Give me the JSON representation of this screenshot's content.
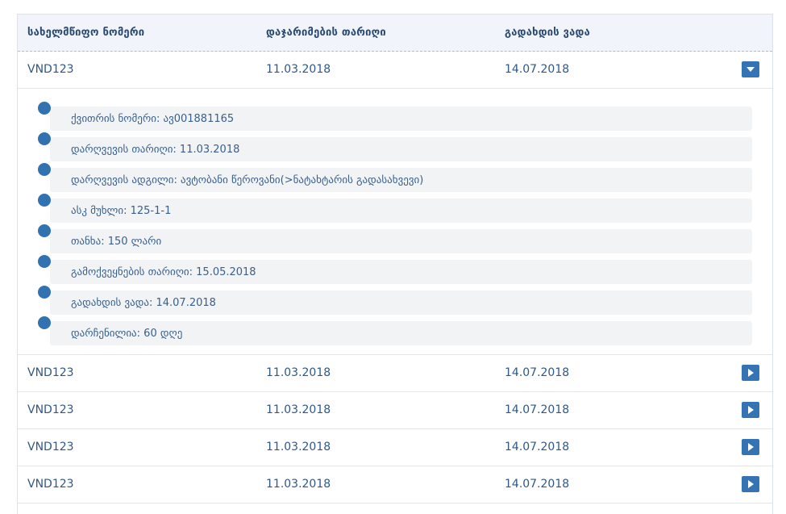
{
  "header": {
    "col_plate": "სახელმწიფო ნომერი",
    "col_violation_date": "დაჯარიმების თარიღი",
    "col_due_date": "გადახდის ვადა"
  },
  "expanded_row": {
    "plate": "VND123",
    "violation_date": "11.03.2018",
    "due_date": "14.07.2018",
    "toggle_icon": "chevron-down-icon"
  },
  "details": [
    "ქვითრის ნომერი: ავ001881165",
    "დარღვევის თარიღი: 11.03.2018",
    "დარღვევის ადგილი: ავტობანი წეროვანი(>ნატახტარის გადასახვევი)",
    "ასკ მუხლი: 125-1-1",
    "თანხა: 150 ლარი",
    "გამოქვეყნების თარიღი: 15.05.2018",
    "გადახდის ვადა: 14.07.2018",
    "დარჩენილია: 60 დღე"
  ],
  "rows": [
    {
      "plate": "VND123",
      "violation_date": "11.03.2018",
      "due_date": "14.07.2018",
      "toggle_icon": "chevron-right-icon"
    },
    {
      "plate": "VND123",
      "violation_date": "11.03.2018",
      "due_date": "14.07.2018",
      "toggle_icon": "chevron-right-icon"
    },
    {
      "plate": "VND123",
      "violation_date": "11.03.2018",
      "due_date": "14.07.2018",
      "toggle_icon": "chevron-right-icon"
    },
    {
      "plate": "VND123",
      "violation_date": "11.03.2018",
      "due_date": "14.07.2018",
      "toggle_icon": "chevron-right-icon"
    }
  ],
  "colors": {
    "accent": "#3574b4",
    "header_bg": "#f1f5fb",
    "detail_bg": "#f1f3f5",
    "text": "#2f5886"
  }
}
